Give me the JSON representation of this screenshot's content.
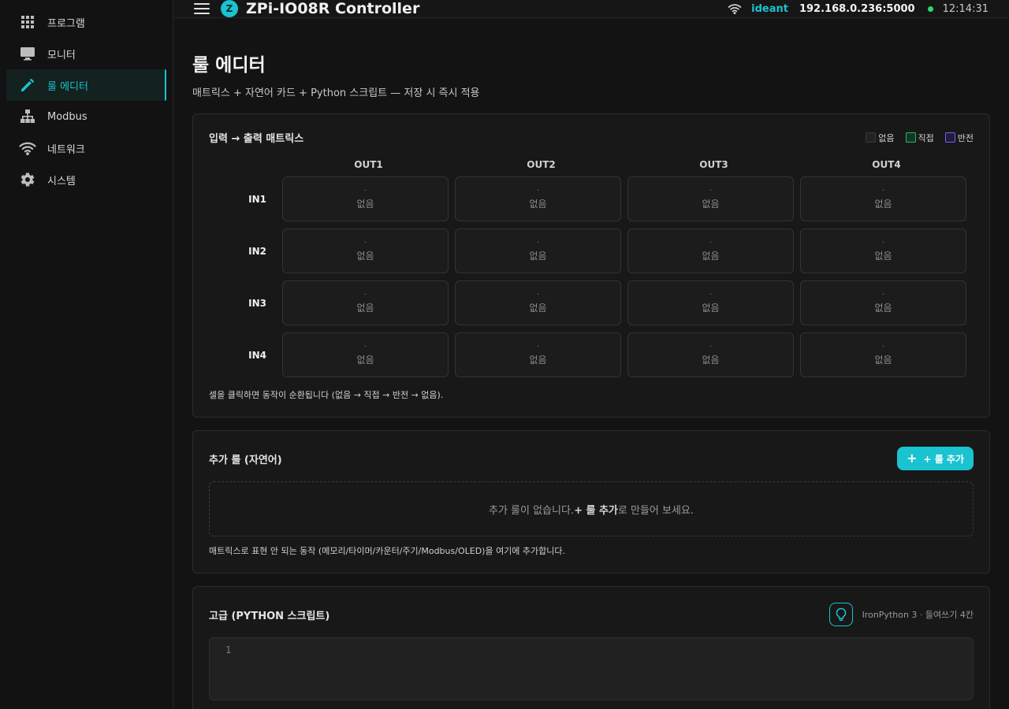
{
  "sidebar": {
    "items": [
      {
        "label": "프로그램",
        "icon": "grid-icon"
      },
      {
        "label": "모니터",
        "icon": "monitor-icon"
      },
      {
        "label": "룰 에디터",
        "icon": "pencil-icon",
        "active": true
      },
      {
        "label": "Modbus",
        "icon": "network-tree-icon"
      },
      {
        "label": "네트워크",
        "icon": "wifi-icon"
      },
      {
        "label": "시스템",
        "icon": "gear-icon"
      }
    ]
  },
  "header": {
    "logo_letter": "Z",
    "title": "ZPi-IO08R Controller",
    "user": "ideant",
    "address": "192.168.0.236:5000",
    "time": "12:14:31"
  },
  "page": {
    "title": "룰 에디터",
    "subtitle": "매트릭스 + 자연어 카드 + Python 스크립트 — 저장 시 즉시 적용"
  },
  "matrix": {
    "title": "입력 → 출력 매트릭스",
    "legend": [
      {
        "label": "없음",
        "color": "#222222",
        "border": "#3a3a3a"
      },
      {
        "label": "직접",
        "color": "#123524",
        "border": "#2fb36a"
      },
      {
        "label": "반전",
        "color": "#221c3a",
        "border": "#7a5cff"
      }
    ],
    "columns": [
      "OUT1",
      "OUT2",
      "OUT3",
      "OUT4"
    ],
    "rows": [
      {
        "label": "IN1",
        "cells": [
          {
            "mark": "·",
            "state": "없음"
          },
          {
            "mark": "·",
            "state": "없음"
          },
          {
            "mark": "·",
            "state": "없음"
          },
          {
            "mark": "·",
            "state": "없음"
          }
        ]
      },
      {
        "label": "IN2",
        "cells": [
          {
            "mark": "·",
            "state": "없음"
          },
          {
            "mark": "·",
            "state": "없음"
          },
          {
            "mark": "·",
            "state": "없음"
          },
          {
            "mark": "·",
            "state": "없음"
          }
        ]
      },
      {
        "label": "IN3",
        "cells": [
          {
            "mark": "·",
            "state": "없음"
          },
          {
            "mark": "·",
            "state": "없음"
          },
          {
            "mark": "·",
            "state": "없음"
          },
          {
            "mark": "·",
            "state": "없음"
          }
        ]
      },
      {
        "label": "IN4",
        "cells": [
          {
            "mark": "·",
            "state": "없음"
          },
          {
            "mark": "·",
            "state": "없음"
          },
          {
            "mark": "·",
            "state": "없음"
          },
          {
            "mark": "·",
            "state": "없음"
          }
        ]
      }
    ],
    "hint": "셀을 클릭하면 동작이 순환됩니다 (없음 → 직접 → 반전 → 없음)."
  },
  "extra_rules": {
    "title": "추가 룰 (자연어)",
    "add_label": "+ 룰 추가",
    "empty_pre": "추가 룰이 없습니다. ",
    "empty_bold": "+ 룰 추가",
    "empty_post": "로 만들어 보세요.",
    "hint": "매트릭스로 표현 안 되는 동작 (메모리/타이머/카운터/주기/Modbus/OLED)을 여기에 추가합니다."
  },
  "python": {
    "title": "고급 (PYTHON 스크립트)",
    "info": "IronPython 3 · 들여쓰기 4칸",
    "line_number": "1"
  },
  "colors": {
    "accent": "#19c3cf",
    "online": "#2ddc6a"
  }
}
